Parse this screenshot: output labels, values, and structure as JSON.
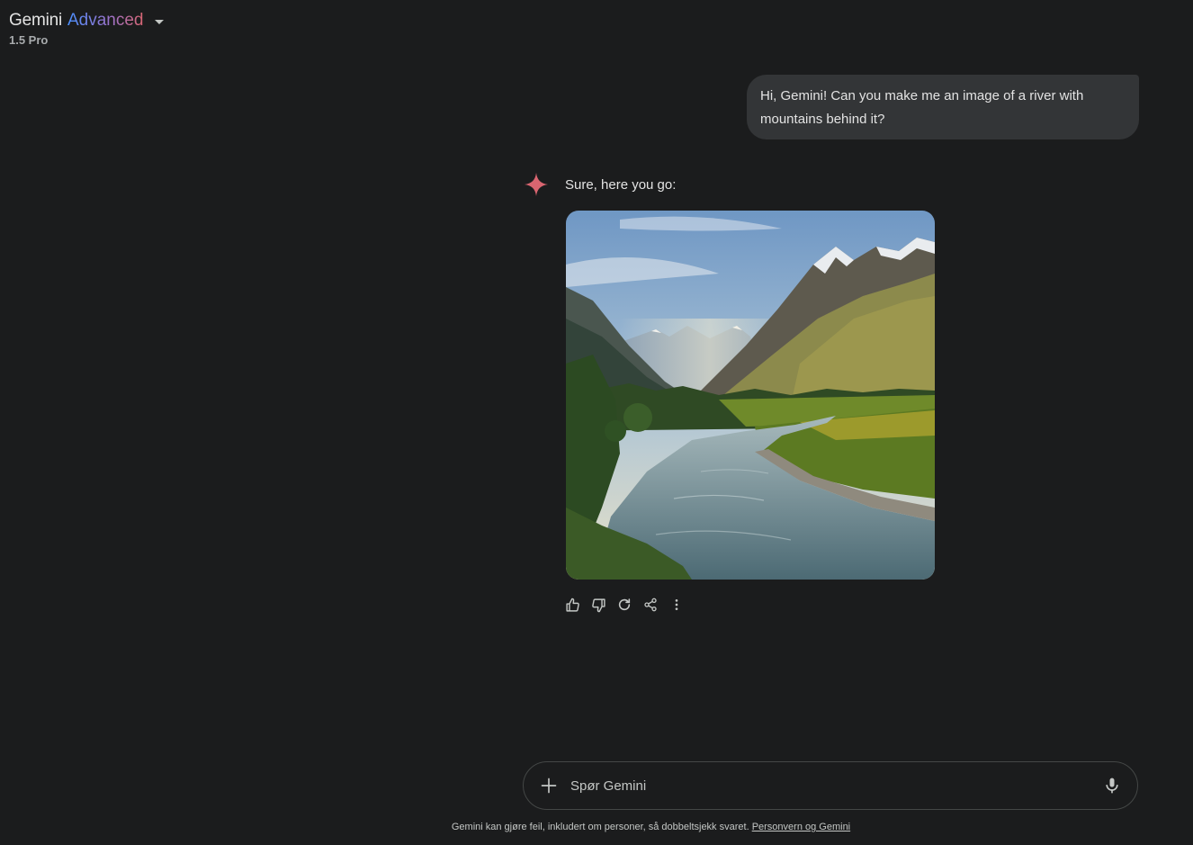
{
  "header": {
    "brand": "Gemini",
    "tier": "Advanced",
    "model_version": "1.5 Pro"
  },
  "conversation": {
    "user_message": "Hi, Gemini! Can you make me an image of a river with mountains behind it?",
    "response_text": "Sure, here you go:",
    "response_image_icon": "generated-landscape-image"
  },
  "actions": [
    {
      "name": "thumbs-up",
      "icon": "thumb-up-icon"
    },
    {
      "name": "thumbs-down",
      "icon": "thumb-down-icon"
    },
    {
      "name": "regenerate",
      "icon": "refresh-icon"
    },
    {
      "name": "share",
      "icon": "share-icon"
    },
    {
      "name": "more",
      "icon": "more-vert-icon"
    }
  ],
  "input": {
    "placeholder": "Spør Gemini"
  },
  "footer": {
    "disclaimer": "Gemini kan gjøre feil, inkludert om personer, så dobbeltsjekk svaret.",
    "link": "Personvern og Gemini"
  },
  "colors": {
    "background": "#1b1c1d",
    "bubble": "#333537",
    "spark": "#d96570",
    "accent_gradient": [
      "#4b90ff",
      "#9b72cb",
      "#d96570"
    ]
  }
}
